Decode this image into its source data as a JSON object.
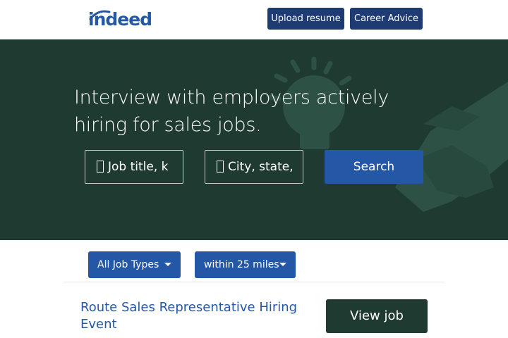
{
  "header": {
    "logo_text": "indeed",
    "upload_resume_label": "Upload resume",
    "career_advice_label": "Career Advice"
  },
  "hero": {
    "headline": "Interview with employers actively hiring for sales jobs.",
    "what_placeholder": "Job title, k",
    "where_placeholder": "City, state,",
    "search_label": "Search",
    "illustration_icons": [
      "lightbulb-icon",
      "handshake-icon"
    ]
  },
  "filters": {
    "job_type_label": "All Job Types",
    "radius_label": "within 25 miles"
  },
  "jobs": [
    {
      "title": "Route Sales Representative Hiring Event",
      "action_label": "View job"
    }
  ],
  "colors": {
    "brand_blue": "#2557a7",
    "header_button": "#1e3b73",
    "hero_green": "#1f3a30",
    "illustration_green": "#2d5245"
  }
}
